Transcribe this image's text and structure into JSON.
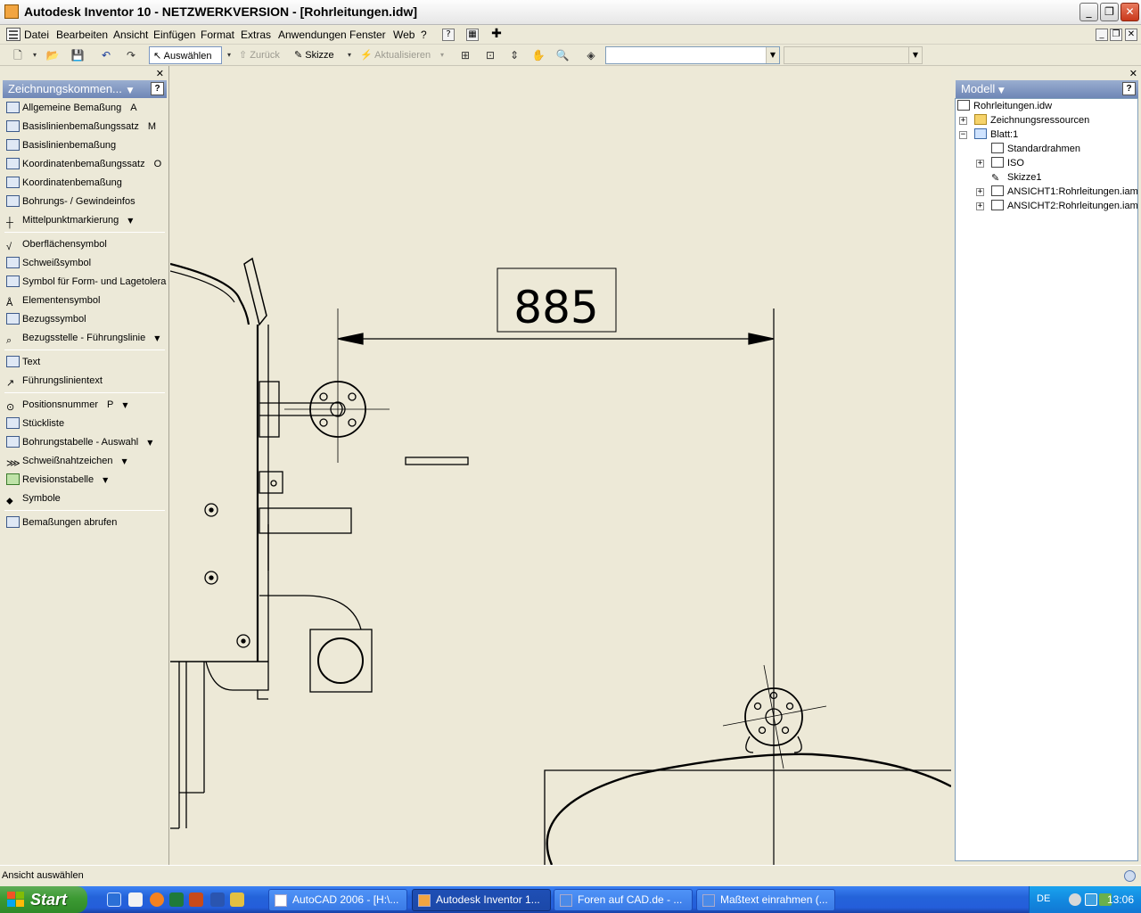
{
  "window": {
    "title": "Autodesk Inventor 10 - NETZWERKVERSION - [Rohrleitungen.idw]"
  },
  "menu": [
    "Datei",
    "Bearbeiten",
    "Ansicht",
    "Einfügen",
    "Format",
    "Extras",
    "Anwendungen",
    "Fenster",
    "Web",
    "?"
  ],
  "toolbar": {
    "select_label": "Auswählen",
    "back_label": "Zurück",
    "sketch_label": "Skizze",
    "update_label": "Aktualisieren"
  },
  "left_panel": {
    "title": "Zeichnungskommen...",
    "groups": [
      [
        {
          "label": "Allgemeine Bemaßung",
          "key": "A"
        },
        {
          "label": "Basislinienbemaßungssatz",
          "key": "M"
        },
        {
          "label": "Basislinienbemaßung",
          "key": ""
        },
        {
          "label": "Koordinatenbemaßungssatz",
          "key": "O"
        },
        {
          "label": "Koordinatenbemaßung",
          "key": ""
        },
        {
          "label": "Bohrungs- / Gewindeinfos",
          "key": ""
        },
        {
          "label": "Mittelpunktmarkierung",
          "key": ""
        }
      ],
      [
        {
          "label": "Oberflächensymbol",
          "key": ""
        },
        {
          "label": "Schweißsymbol",
          "key": ""
        },
        {
          "label": "Symbol für Form- und Lagetolerar",
          "key": ""
        },
        {
          "label": "Elementensymbol",
          "key": ""
        },
        {
          "label": "Bezugssymbol",
          "key": ""
        },
        {
          "label": "Bezugsstelle - Führungslinie",
          "key": ""
        }
      ],
      [
        {
          "label": "Text",
          "key": ""
        },
        {
          "label": "Führungslinientext",
          "key": ""
        }
      ],
      [
        {
          "label": "Positionsnummer",
          "key": "P"
        },
        {
          "label": "Stückliste",
          "key": ""
        },
        {
          "label": "Bohrungstabelle - Auswahl",
          "key": ""
        },
        {
          "label": "Schweißnahtzeichen",
          "key": ""
        },
        {
          "label": "Revisionstabelle",
          "key": ""
        },
        {
          "label": "Symbole",
          "key": ""
        }
      ],
      [
        {
          "label": "Bemaßungen abrufen",
          "key": ""
        }
      ]
    ]
  },
  "drawing": {
    "dimension_value": "885"
  },
  "browser": {
    "title": "Modell",
    "nodes": [
      {
        "label": "Rohrleitungen.idw"
      },
      {
        "label": "Zeichnungsressourcen"
      },
      {
        "label": "Blatt:1"
      },
      {
        "label": "Standardrahmen"
      },
      {
        "label": "ISO"
      },
      {
        "label": "Skizze1"
      },
      {
        "label": "ANSICHT1:Rohrleitungen.iam"
      },
      {
        "label": "ANSICHT2:Rohrleitungen.iam"
      }
    ]
  },
  "status": {
    "text": "Ansicht auswählen"
  },
  "taskbar": {
    "start_label": "Start",
    "tasks": [
      {
        "label": "AutoCAD 2006 - [H:\\..."
      },
      {
        "label": "Autodesk Inventor 1..."
      },
      {
        "label": "Foren auf CAD.de - ..."
      },
      {
        "label": "Maßtext einrahmen (..."
      }
    ],
    "language": "DE",
    "clock": "13:06"
  },
  "colors": {
    "drawing_background": "#ede9d7",
    "panel_header": "#6e86b6",
    "taskbar": "#245edb",
    "start_button": "#3c9a33"
  }
}
